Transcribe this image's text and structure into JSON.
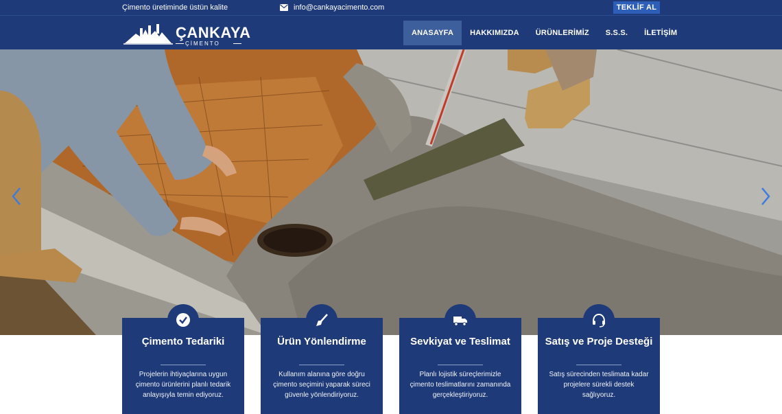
{
  "topbar": {
    "tagline": "Çimento üretiminde üstün kalite",
    "email": "info@cankayacimento.com",
    "cta_label": "TEKLİF AL"
  },
  "brand": {
    "name": "ÇANKAYA",
    "subtitle": "ÇİMENTO"
  },
  "nav": {
    "items": [
      {
        "label": "ANASAYFA",
        "active": true
      },
      {
        "label": "HAKKIMIZDA",
        "active": false
      },
      {
        "label": "ÜRÜNLERİMİZ",
        "active": false
      },
      {
        "label": "S.S.S.",
        "active": false
      },
      {
        "label": "İLETİŞİM",
        "active": false
      }
    ]
  },
  "hero": {
    "prev_icon": "chevron-left-icon",
    "next_icon": "chevron-right-icon"
  },
  "cards": [
    {
      "icon": "check-circle-icon",
      "title": "Çimento Tedariki",
      "text": "Projelerin ihtiyaçlarına uygun çimento ürünlerini planlı tedarik anlayışıyla temin ediyoruz."
    },
    {
      "icon": "trowel-icon",
      "title": "Ürün Yönlendirme",
      "text": "Kullanım alanına göre doğru çimento seçimini yaparak süreci güvenle yönlendiriyoruz."
    },
    {
      "icon": "truck-icon",
      "title": "Sevkiyat ve Teslimat",
      "text": "Planlı lojistik süreçlerimizle çimento teslimatlarını zamanında gerçekleştiriyoruz."
    },
    {
      "icon": "headset-icon",
      "title": "Satış ve Proje Desteği",
      "text": "Satış sürecinden teslimata kadar projelere sürekli destek sağlıyoruz."
    }
  ],
  "colors": {
    "primary": "#1e3a78",
    "accent": "#2d5fb8",
    "nav_active": "#3d5f9c"
  }
}
